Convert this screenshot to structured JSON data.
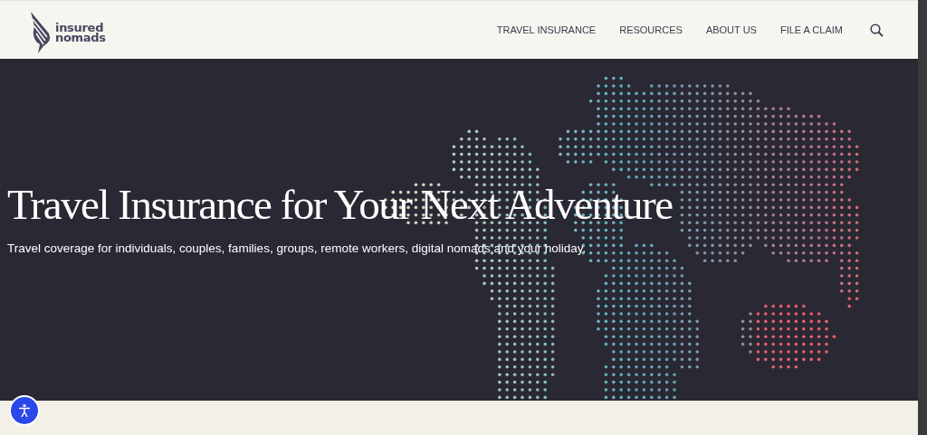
{
  "header": {
    "logo": {
      "line_1": "insured",
      "line_2": "nomads"
    },
    "nav": [
      {
        "label": "TRAVEL INSURANCE"
      },
      {
        "label": "RESOURCES"
      },
      {
        "label": "ABOUT US"
      },
      {
        "label": "FILE A CLAIM"
      }
    ]
  },
  "hero": {
    "title": "Travel Insurance for Your Next Adventure",
    "subtitle": "Travel coverage for individuals, couples, families, groups, remote workers, digital nomads and your holiday."
  }
}
